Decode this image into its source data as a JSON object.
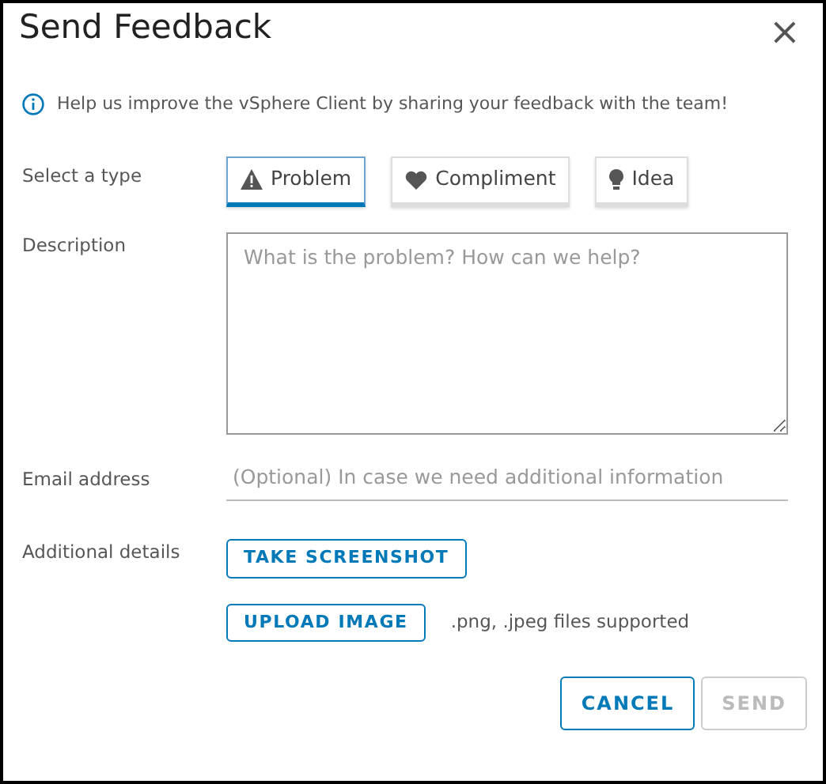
{
  "dialog": {
    "title": "Send Feedback",
    "close": "×"
  },
  "info": "Help us improve the vSphere Client by sharing your feedback with the team!",
  "type_label": "Select a type",
  "types": [
    {
      "label": "Problem",
      "kind": "warning",
      "selected": true
    },
    {
      "label": "Compliment",
      "kind": "heart",
      "selected": false
    },
    {
      "label": "Idea",
      "kind": "bulb",
      "selected": false
    }
  ],
  "description": {
    "label": "Description",
    "placeholder": "What is the problem? How can we help?"
  },
  "email": {
    "label": "Email address",
    "placeholder": "(Optional) In case we need additional information"
  },
  "details": {
    "label": "Additional details",
    "screenshot_button": "TAKE SCREENSHOT",
    "upload_button": "UPLOAD IMAGE",
    "note": ".png, .jpeg files supported"
  },
  "buttons": [
    {
      "label": "CANCEL",
      "disabled": false
    },
    {
      "label": "SEND",
      "disabled": true
    }
  ]
}
